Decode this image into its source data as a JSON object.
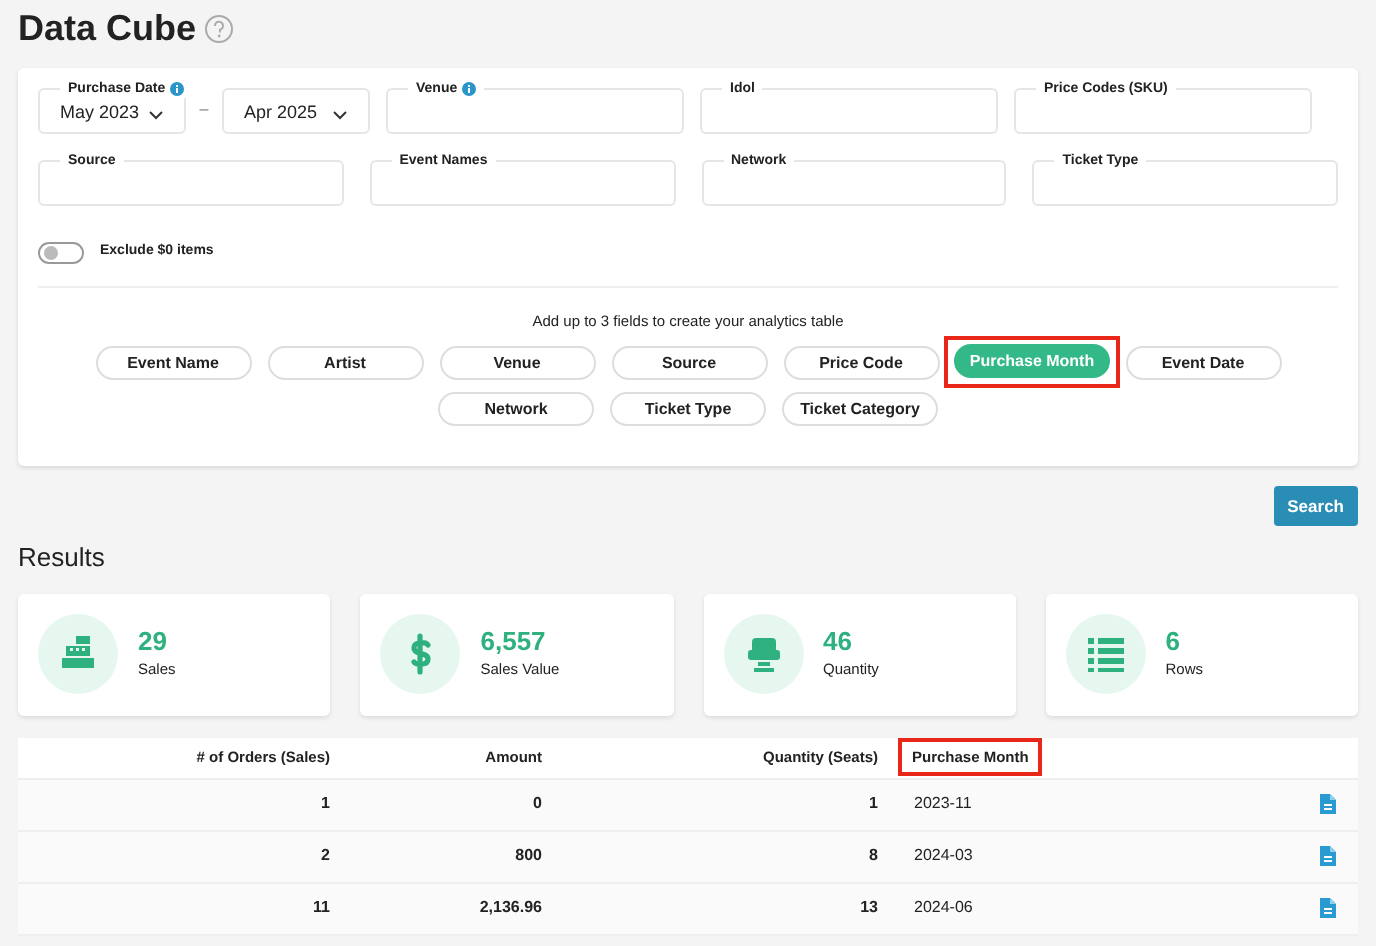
{
  "title": "Data Cube",
  "filters": {
    "purchase_date": {
      "label": "Purchase Date",
      "from": "May 2023",
      "to": "Apr 2025",
      "separator": "–"
    },
    "fields_row1": [
      {
        "label": "Venue",
        "info": true
      },
      {
        "label": "Idol",
        "info": false
      },
      {
        "label": "Price Codes (SKU)",
        "info": false
      }
    ],
    "fields_row2": [
      {
        "label": "Source"
      },
      {
        "label": "Event Names"
      },
      {
        "label": "Network"
      },
      {
        "label": "Ticket Type"
      }
    ],
    "exclude_toggle": {
      "label": "Exclude $0 items",
      "on": false
    }
  },
  "fields_hint": "Add up to 3 fields to create your analytics table",
  "field_chips": [
    [
      {
        "label": "Event Name",
        "selected": false,
        "highlighted": false
      },
      {
        "label": "Artist",
        "selected": false,
        "highlighted": false
      },
      {
        "label": "Venue",
        "selected": false,
        "highlighted": false
      },
      {
        "label": "Source",
        "selected": false,
        "highlighted": false
      },
      {
        "label": "Price Code",
        "selected": false,
        "highlighted": false
      },
      {
        "label": "Purchase Month",
        "selected": true,
        "highlighted": true
      },
      {
        "label": "Event Date",
        "selected": false,
        "highlighted": false
      }
    ],
    [
      {
        "label": "Network",
        "selected": false,
        "highlighted": false
      },
      {
        "label": "Ticket Type",
        "selected": false,
        "highlighted": false
      },
      {
        "label": "Ticket Category",
        "selected": false,
        "highlighted": false
      }
    ]
  ],
  "search_button": "Search",
  "results_title": "Results",
  "stats": [
    {
      "kind": "register",
      "value": "29",
      "label": "Sales"
    },
    {
      "kind": "dollar",
      "value": "6,557",
      "label": "Sales Value"
    },
    {
      "kind": "seat",
      "value": "46",
      "label": "Quantity"
    },
    {
      "kind": "list",
      "value": "6",
      "label": "Rows"
    }
  ],
  "table": {
    "columns": [
      {
        "label": "# of Orders (Sales)",
        "highlighted": false
      },
      {
        "label": "Amount",
        "highlighted": false
      },
      {
        "label": "Quantity (Seats)",
        "highlighted": false
      },
      {
        "label": "Purchase Month",
        "highlighted": true
      }
    ],
    "rows": [
      [
        "1",
        "0",
        "1",
        "2023-11"
      ],
      [
        "2",
        "800",
        "8",
        "2024-03"
      ],
      [
        "11",
        "2,136.96",
        "13",
        "2024-06"
      ]
    ]
  }
}
